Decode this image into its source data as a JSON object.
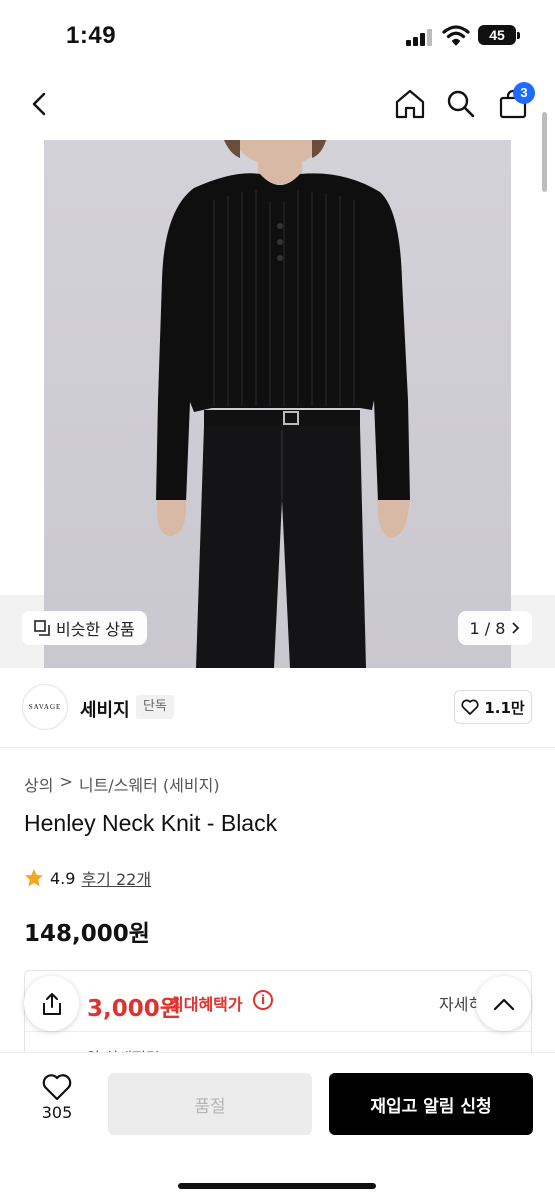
{
  "status_bar": {
    "time": "1:49",
    "battery": "45"
  },
  "nav": {
    "cart_count": "3"
  },
  "gallery": {
    "similar_label": "비슷한 상품",
    "pager": "1 / 8"
  },
  "brand": {
    "logo_text": "SAVAGE",
    "name": "세비지",
    "badge": "단독",
    "likes": "1.1만"
  },
  "breadcrumb": {
    "category": "상의",
    "separator": ">",
    "subcategory": "니트/스웨터 (세비지)"
  },
  "product": {
    "title": "Henley Neck Knit - Black",
    "rating": "4.9",
    "reviews": "후기 22개",
    "price": "148,000원"
  },
  "benefit": {
    "max_price": "3,000원",
    "label": "최대혜택가",
    "info_icon": "i",
    "detail": "자세히",
    "sub": "3,000원 최대적립"
  },
  "bottom": {
    "wish_count": "305",
    "soldout": "품절",
    "restock": "재입고 알림 신청"
  },
  "colors": {
    "accent": "#1f6bff",
    "sale": "#e0332f",
    "primary_button": "#000000"
  }
}
